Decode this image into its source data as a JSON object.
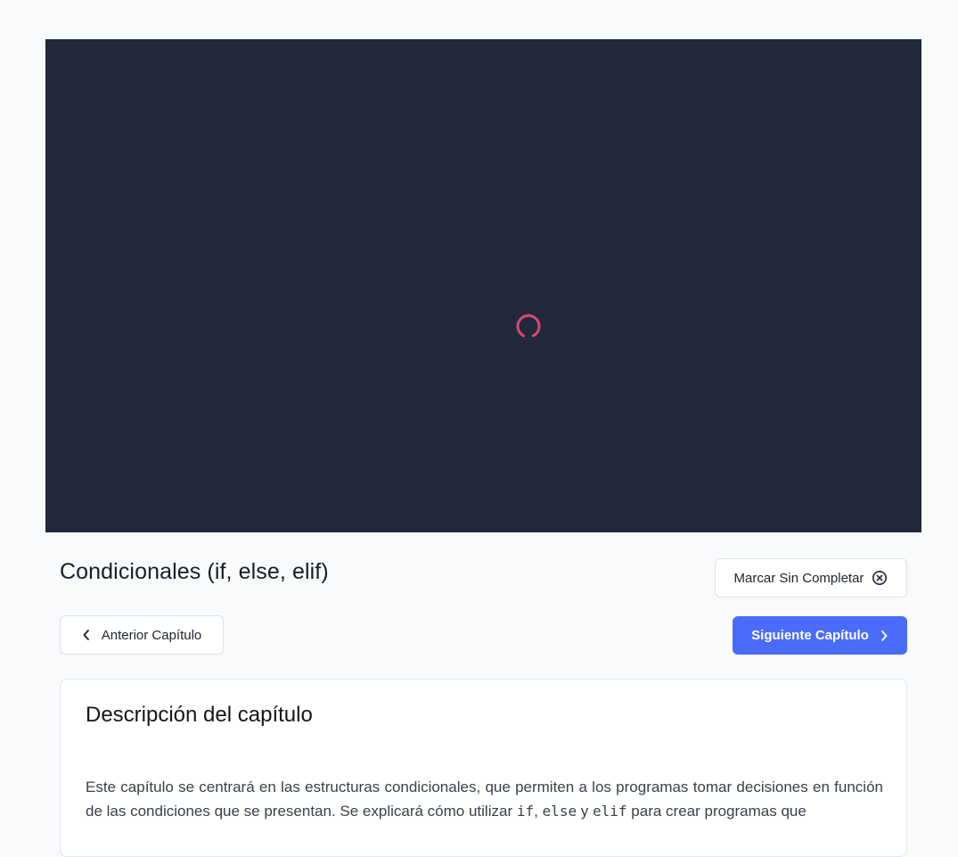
{
  "player": {
    "state": "loading",
    "spinner_color": "#e0456a",
    "background": "#22283b"
  },
  "chapter": {
    "title": "Condicionales (if, else, elif)"
  },
  "actions": {
    "mark_label": "Marcar Sin Completar",
    "mark_icon": "x-circle-icon",
    "prev_label": "Anterior Capítulo",
    "prev_icon": "chevron-left-icon",
    "next_label": "Siguiente Capítulo",
    "next_icon": "chevron-right-icon",
    "accent_color": "#4b6bfb"
  },
  "description": {
    "heading": "Descripción del capítulo",
    "text_part1": "Este capítulo se centrará en las estructuras condicionales, que permiten a los programas tomar decisiones en función de las condiciones que se presentan. Se explicará cómo utilizar ",
    "code1": "if",
    "sep1": ", ",
    "code2": "else",
    "sep2": " y ",
    "code3": "elif",
    "text_part2": " para crear programas que"
  }
}
